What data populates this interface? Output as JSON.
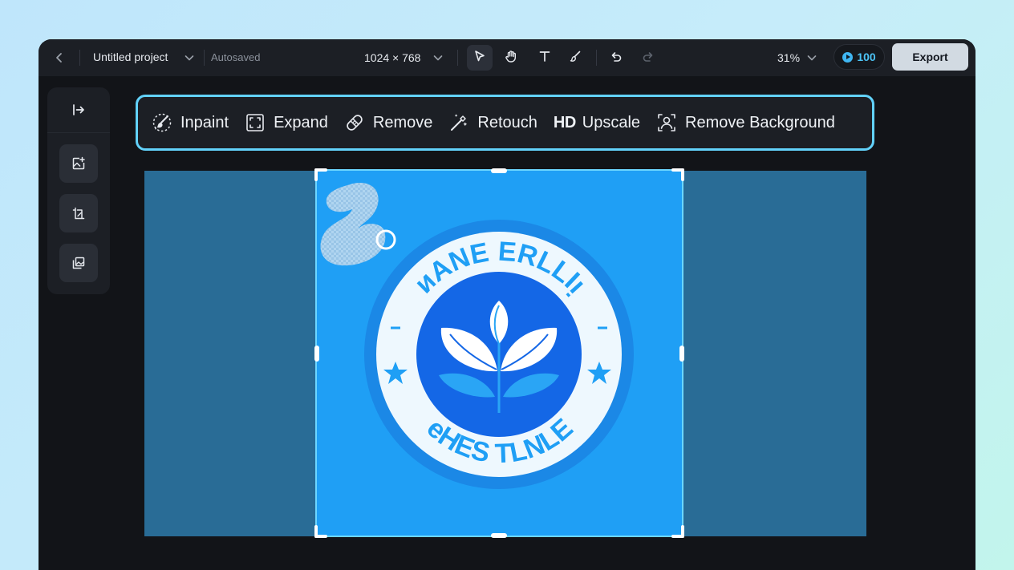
{
  "topbar": {
    "back_icon": "chevron-left-icon",
    "project_title": "Untitled project",
    "autosave_status": "Autosaved",
    "canvas_size": "1024 × 768",
    "tools": [
      "select-icon",
      "hand-icon",
      "text-icon",
      "brush-icon"
    ],
    "history": [
      "undo-icon",
      "redo-icon"
    ],
    "zoom_level": "31%",
    "credits": "100",
    "export_label": "Export"
  },
  "sidebar": {
    "items": [
      "collapse-icon",
      "add-image-icon",
      "resize-icon",
      "layers-icon"
    ]
  },
  "ai_toolbar": {
    "items": [
      {
        "label": "Inpaint",
        "icon": "inpaint-brush-icon"
      },
      {
        "label": "Expand",
        "icon": "expand-icon"
      },
      {
        "label": "Remove",
        "icon": "eraser-icon"
      },
      {
        "label": "Retouch",
        "icon": "magic-wand-icon"
      },
      {
        "label": "Upscale",
        "badge": "HD"
      },
      {
        "label": "Remove Background",
        "icon": "remove-bg-icon"
      }
    ]
  },
  "logo": {
    "top_text": "ᴎANE ERLLIᴉ",
    "bottom_text": "eHES TLNLE"
  },
  "colors": {
    "accent": "#62d2fb",
    "image_bg": "#1f9ff5",
    "canvas_bg": "#296c96",
    "export_bg": "#d2dae2"
  }
}
